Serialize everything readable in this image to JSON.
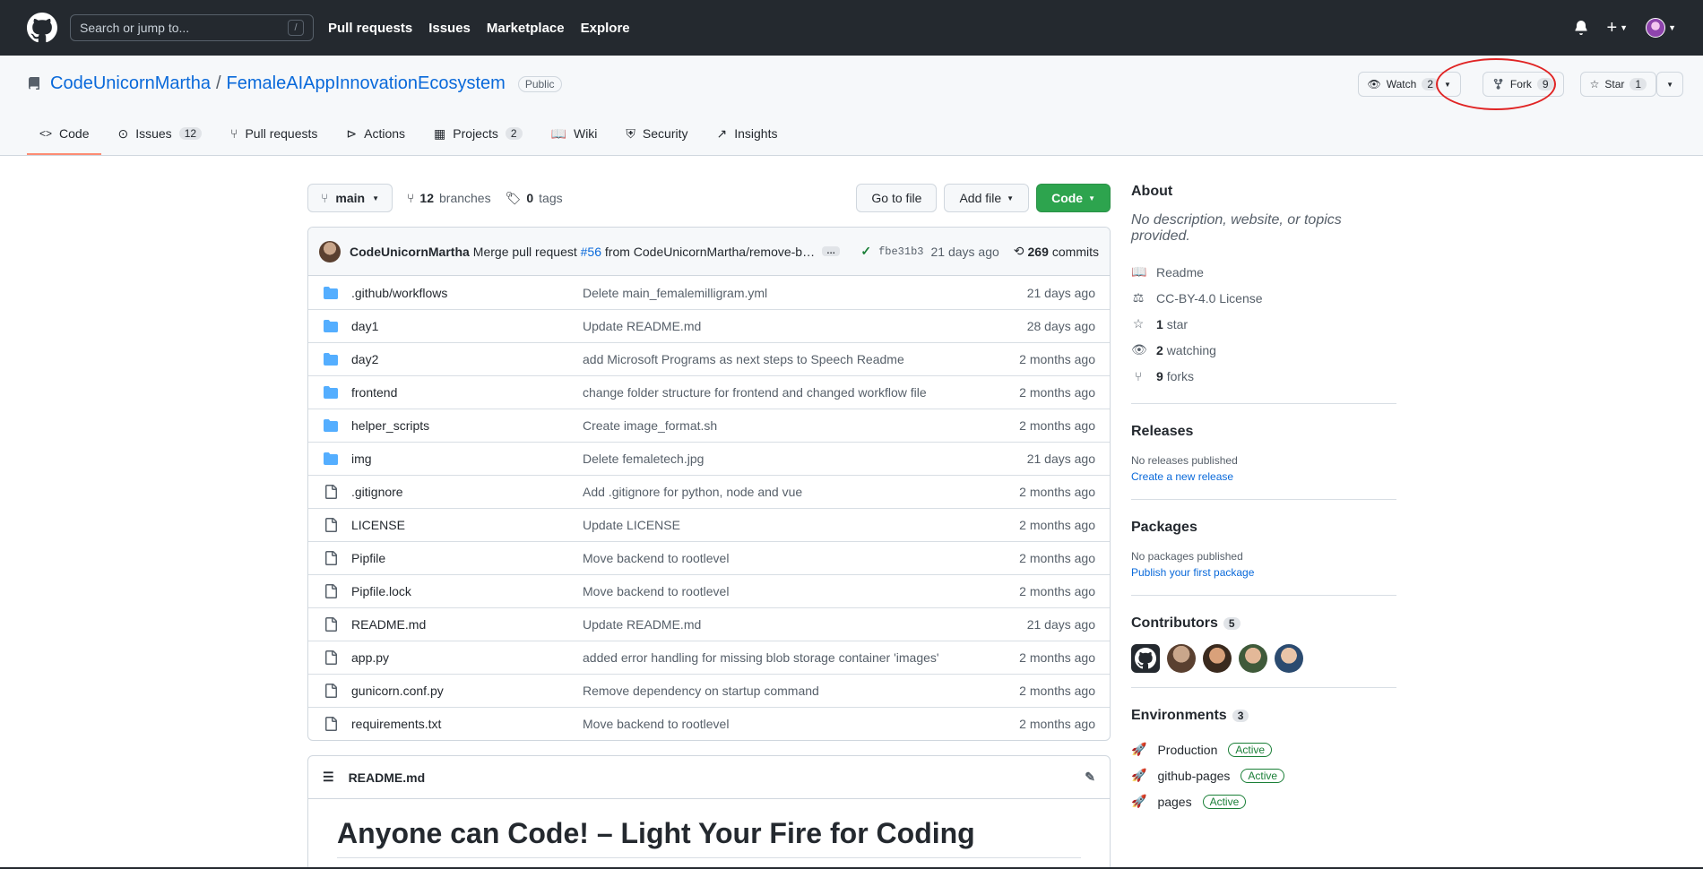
{
  "header": {
    "search_placeholder": "Search or jump to...",
    "search_key": "/",
    "nav": [
      "Pull requests",
      "Issues",
      "Marketplace",
      "Explore"
    ]
  },
  "repo": {
    "owner": "CodeUnicornMartha",
    "separator": "/",
    "name": "FemaleAIAppInnovationEcosystem",
    "visibility": "Public",
    "watch_label": "Watch",
    "watch_count": "2",
    "fork_label": "Fork",
    "fork_count": "9",
    "star_label": "Star",
    "star_count": "1"
  },
  "tabs": [
    {
      "label": "Code",
      "icon": "code-icon"
    },
    {
      "label": "Issues",
      "count": "12",
      "icon": "issue-icon"
    },
    {
      "label": "Pull requests",
      "icon": "pull-request-icon"
    },
    {
      "label": "Actions",
      "icon": "play-icon"
    },
    {
      "label": "Projects",
      "count": "2",
      "icon": "project-icon"
    },
    {
      "label": "Wiki",
      "icon": "book-icon"
    },
    {
      "label": "Security",
      "icon": "shield-icon"
    },
    {
      "label": "Insights",
      "icon": "graph-icon"
    }
  ],
  "toolbar": {
    "branch": "main",
    "branches_count": "12",
    "branches_label": "branches",
    "tags_count": "0",
    "tags_label": "tags",
    "go_to_file": "Go to file",
    "add_file": "Add file",
    "code": "Code"
  },
  "commit": {
    "author": "CodeUnicornMartha",
    "message_prefix": "Merge pull request",
    "pr_link": "#56",
    "message_suffix": "from CodeUnicornMartha/remove-b…",
    "ellipsis": "…",
    "sha": "fbe31b3",
    "age": "21 days ago",
    "count": "269",
    "count_label": "commits"
  },
  "files": [
    {
      "type": "dir",
      "name": ".github/workflows",
      "msg": "Delete main_femalemilligram.yml",
      "age": "21 days ago"
    },
    {
      "type": "dir",
      "name": "day1",
      "msg": "Update README.md",
      "age": "28 days ago"
    },
    {
      "type": "dir",
      "name": "day2",
      "msg": "add Microsoft Programs as next steps to Speech Readme",
      "age": "2 months ago"
    },
    {
      "type": "dir",
      "name": "frontend",
      "msg": "change folder structure for frontend and changed workflow file",
      "age": "2 months ago"
    },
    {
      "type": "dir",
      "name": "helper_scripts",
      "msg": "Create image_format.sh",
      "age": "2 months ago"
    },
    {
      "type": "dir",
      "name": "img",
      "msg": "Delete femaletech.jpg",
      "age": "21 days ago"
    },
    {
      "type": "file",
      "name": ".gitignore",
      "msg": "Add .gitignore for python, node and vue",
      "age": "2 months ago"
    },
    {
      "type": "file",
      "name": "LICENSE",
      "msg": "Update LICENSE",
      "age": "2 months ago"
    },
    {
      "type": "file",
      "name": "Pipfile",
      "msg": "Move backend to rootlevel",
      "age": "2 months ago"
    },
    {
      "type": "file",
      "name": "Pipfile.lock",
      "msg": "Move backend to rootlevel",
      "age": "2 months ago"
    },
    {
      "type": "file",
      "name": "README.md",
      "msg": "Update README.md",
      "age": "21 days ago"
    },
    {
      "type": "file",
      "name": "app.py",
      "msg": "added error handling for missing blob storage container 'images'",
      "age": "2 months ago"
    },
    {
      "type": "file",
      "name": "gunicorn.conf.py",
      "msg": "Remove dependency on startup command",
      "age": "2 months ago"
    },
    {
      "type": "file",
      "name": "requirements.txt",
      "msg": "Move backend to rootlevel",
      "age": "2 months ago"
    }
  ],
  "readme": {
    "filename": "README.md",
    "title": "Anyone can Code! – Light Your Fire for Coding"
  },
  "sidebar": {
    "about_title": "About",
    "about_desc": "No description, website, or topics provided.",
    "readme": "Readme",
    "license": "CC-BY-4.0 License",
    "stars_count": "1",
    "stars_label": "star",
    "watching_count": "2",
    "watching_label": "watching",
    "forks_count": "9",
    "forks_label": "forks",
    "releases_title": "Releases",
    "releases_none": "No releases published",
    "releases_link": "Create a new release",
    "packages_title": "Packages",
    "packages_none": "No packages published",
    "packages_link": "Publish your first package",
    "contributors_title": "Contributors",
    "contributors_count": "5",
    "environments_title": "Environments",
    "environments_count": "3",
    "environments": [
      {
        "name": "Production",
        "status": "Active"
      },
      {
        "name": "github-pages",
        "status": "Active"
      },
      {
        "name": "pages",
        "status": "Active"
      }
    ]
  },
  "colors": {
    "header_bg": "#24292f",
    "link": "#0969da",
    "green_button": "#2da44e",
    "folder": "#54aeff",
    "tab_underline": "#fd8c73",
    "annotation": "#e02424"
  }
}
